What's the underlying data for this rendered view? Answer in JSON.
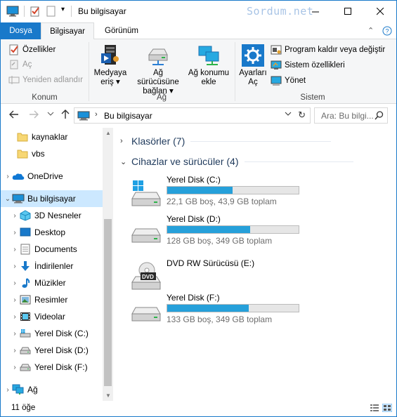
{
  "window": {
    "title": "Bu bilgisayar",
    "watermark": "Sordum.net"
  },
  "tabs": {
    "file": "Dosya",
    "computer": "Bilgisayar",
    "view": "Görünüm"
  },
  "ribbon": {
    "location": {
      "properties": "Özellikler",
      "open": "Aç",
      "rename": "Yeniden adlandır",
      "group": "Konum"
    },
    "network": {
      "media_line1": "Medyaya",
      "media_line2": "eriş ▾",
      "map_line1": "Ağ sürücüsüne",
      "map_line2": "bağlan ▾",
      "add_line1": "Ağ konumu",
      "add_line2": "ekle",
      "group": "Ağ"
    },
    "system": {
      "settings_line1": "Ayarları",
      "settings_line2": "Aç",
      "uninstall": "Program kaldır veya değiştir",
      "sysprops": "Sistem özellikleri",
      "manage": "Yönet",
      "group": "Sistem"
    }
  },
  "address": {
    "crumb": "Bu bilgisayar",
    "search_placeholder": "Ara: Bu bilgi..."
  },
  "sidebar": {
    "items": [
      {
        "label": "kaynaklar",
        "icon": "folder-icon"
      },
      {
        "label": "vbs",
        "icon": "folder-icon"
      },
      {
        "label": "OneDrive",
        "icon": "cloud-icon"
      },
      {
        "label": "Bu bilgisayar",
        "icon": "computer-icon"
      },
      {
        "label": "3D Nesneler",
        "icon": "cube-icon"
      },
      {
        "label": "Desktop",
        "icon": "desktop-icon"
      },
      {
        "label": "Documents",
        "icon": "documents-icon"
      },
      {
        "label": "İndirilenler",
        "icon": "download-icon"
      },
      {
        "label": "Müzikler",
        "icon": "music-icon"
      },
      {
        "label": "Resimler",
        "icon": "pictures-icon"
      },
      {
        "label": "Videolar",
        "icon": "videos-icon"
      },
      {
        "label": "Yerel Disk (C:)",
        "icon": "drive-icon"
      },
      {
        "label": "Yerel Disk (D:)",
        "icon": "drive-icon"
      },
      {
        "label": "Yerel Disk (F:)",
        "icon": "drive-icon"
      },
      {
        "label": "Ağ",
        "icon": "network-icon"
      }
    ]
  },
  "content": {
    "folders_header": "Klasörler (7)",
    "devices_header": "Cihazlar ve sürücüler (4)",
    "drives": [
      {
        "name": "Yerel Disk (C:)",
        "info": "22,1 GB boş, 43,9 GB toplam",
        "used_fraction": 0.497
      },
      {
        "name": "Yerel Disk (D:)",
        "info": "128 GB boş, 349 GB toplam",
        "used_fraction": 0.633
      },
      {
        "name": "DVD RW Sürücüsü (E:)",
        "info": "",
        "used_fraction": null
      },
      {
        "name": "Yerel Disk (F:)",
        "info": "133 GB boş, 349 GB toplam",
        "used_fraction": 0.619
      }
    ],
    "dvd_label": "DVD"
  },
  "status": {
    "count": "11 öğe"
  },
  "colors": {
    "accent": "#1979ca",
    "bar_fill": "#26a0da",
    "selected": "#cce8ff"
  }
}
